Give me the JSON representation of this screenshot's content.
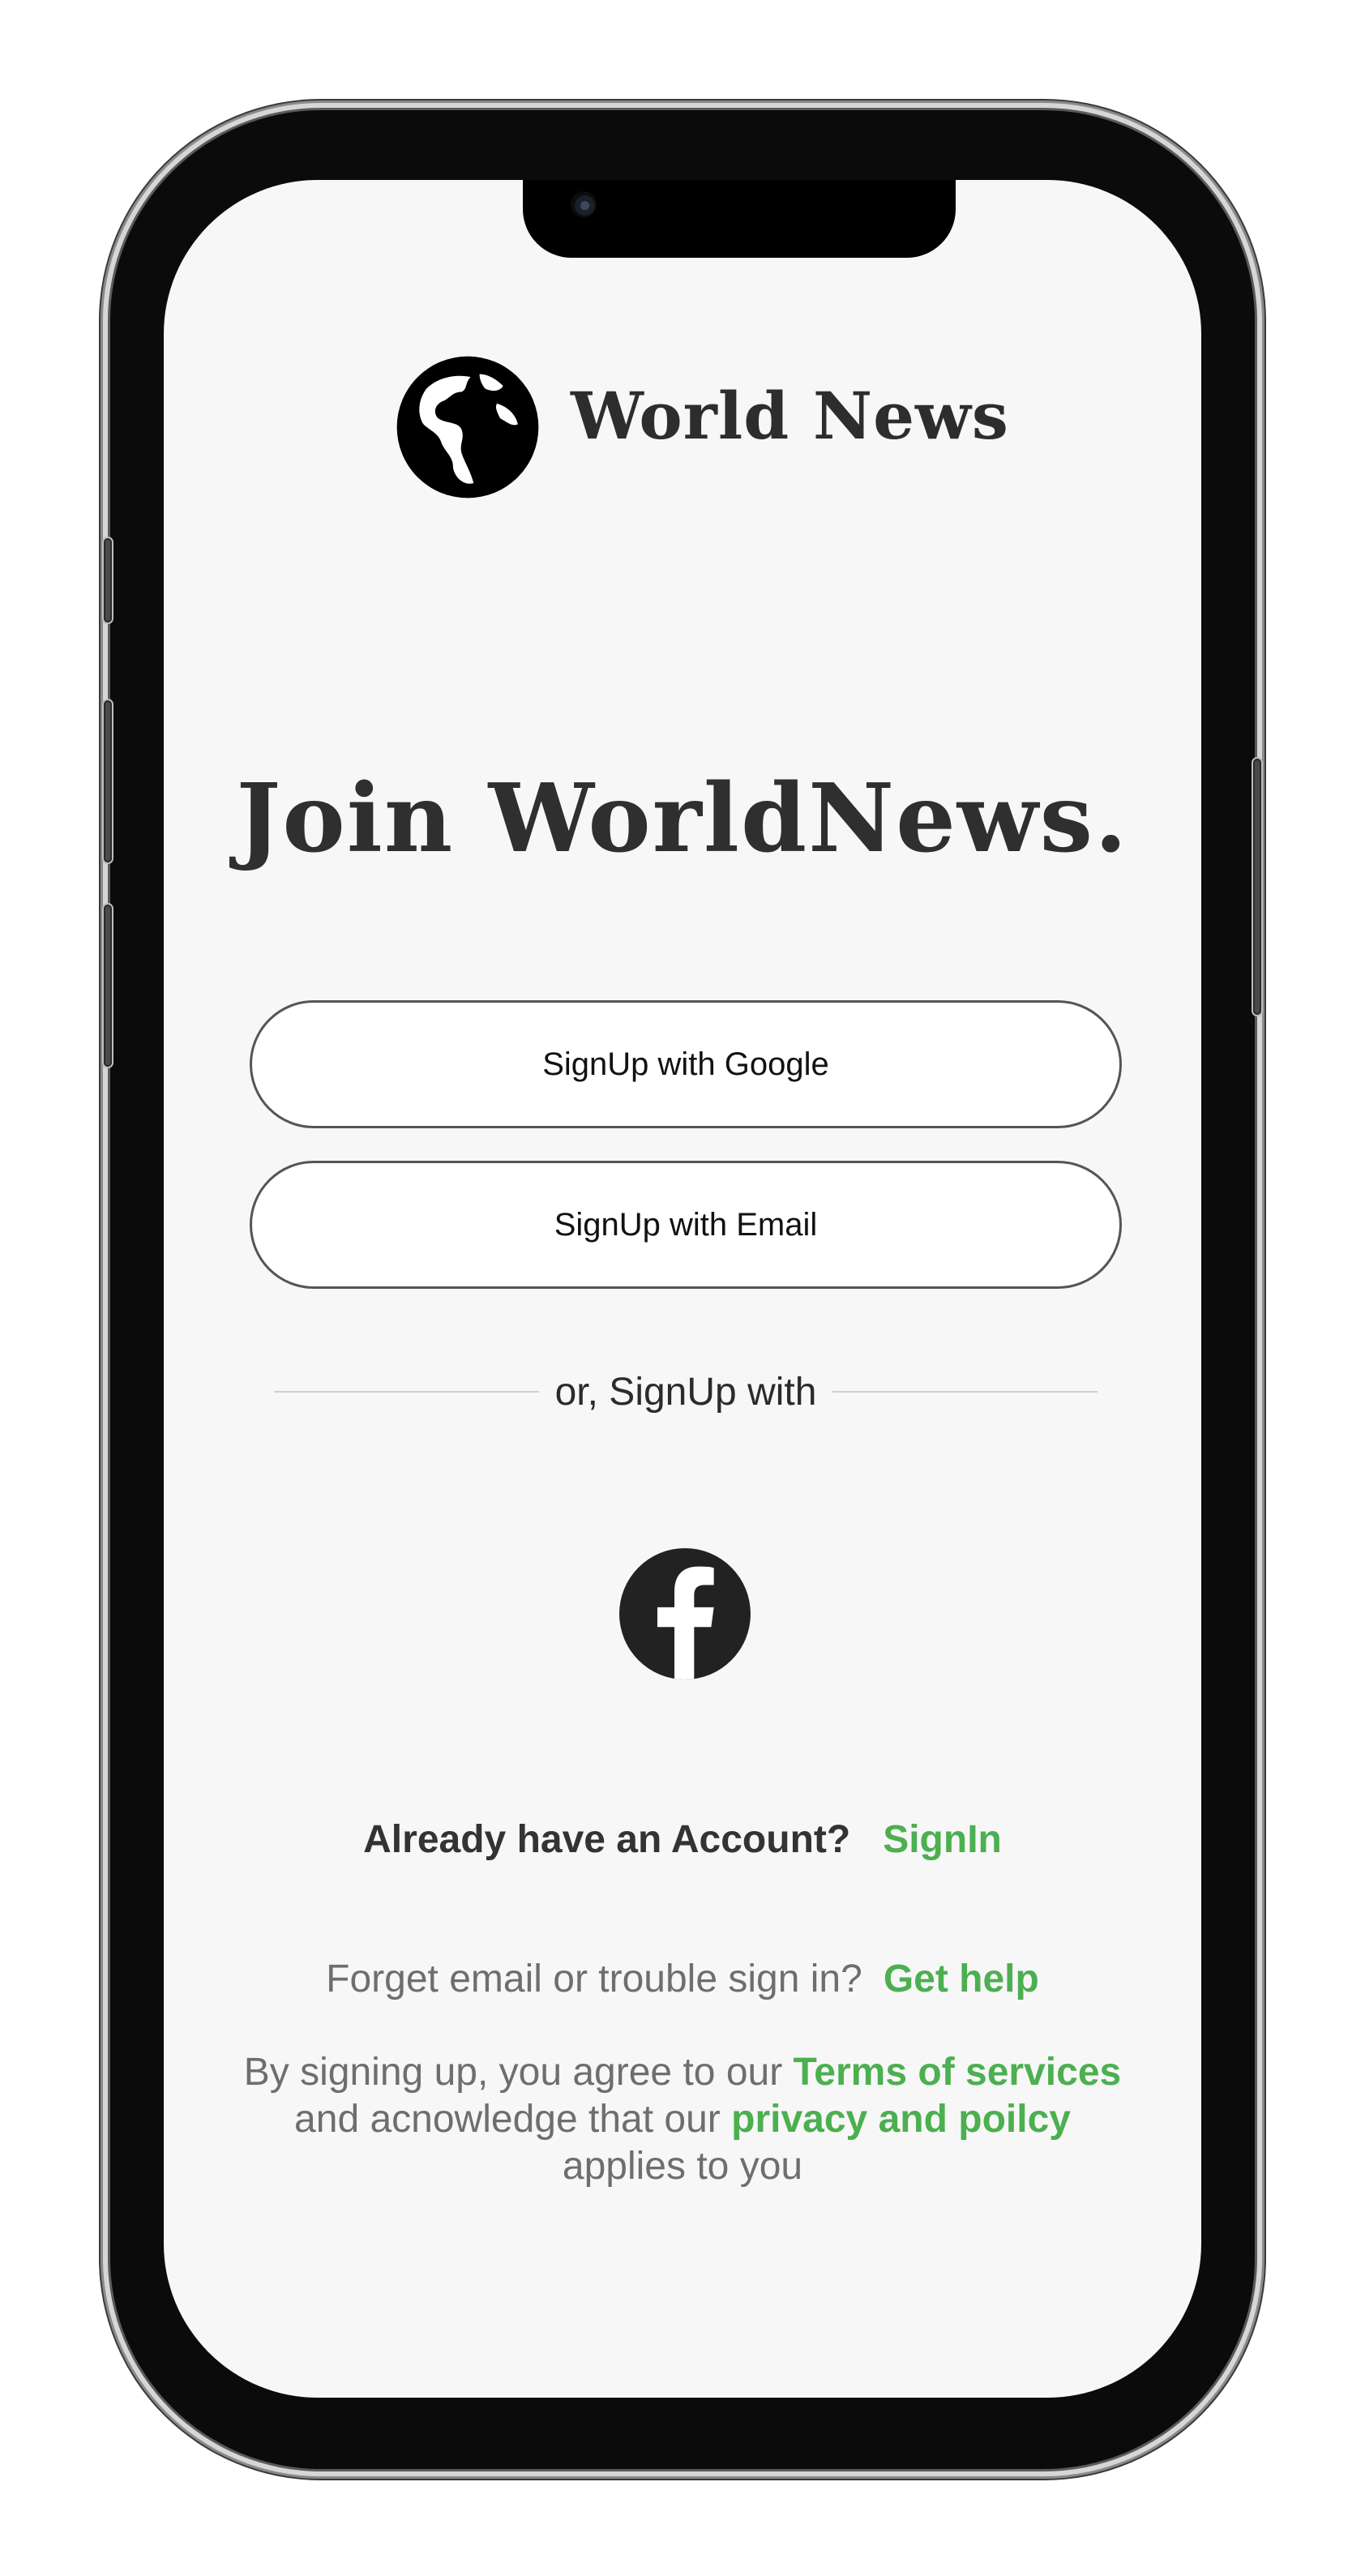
{
  "brand": {
    "name": "World News",
    "logo_icon": "globe-icon"
  },
  "headline": "Join WorldNews.",
  "buttons": {
    "google_label": "SignUp with Google",
    "email_label": "SignUp with Email"
  },
  "divider_text": "or, SignUp with",
  "social": {
    "facebook_icon": "facebook-icon"
  },
  "account": {
    "question": "Already have an Account?",
    "signin_label": "SignIn"
  },
  "help": {
    "question": "Forget email or trouble sign in?",
    "link_label": "Get help"
  },
  "legal": {
    "prefix": "By signing up, you agree to our",
    "terms_label": "Terms of services",
    "middle": "and acnowledge that our",
    "privacy_label": "privacy and poilcy",
    "suffix": "applies to you"
  },
  "colors": {
    "accent": "#4caf50",
    "heading": "#2f2f2f",
    "muted": "#6e6e6e",
    "background": "#f7f7f7"
  }
}
